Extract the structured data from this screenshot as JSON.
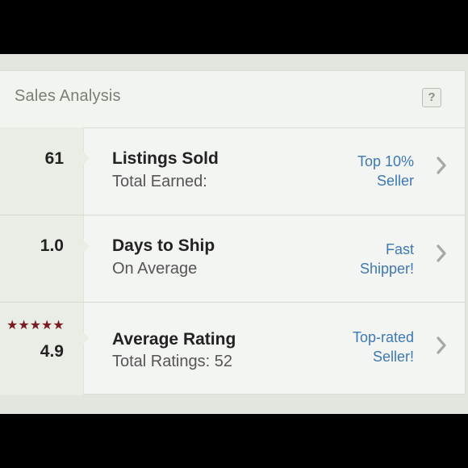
{
  "panel": {
    "title": "Sales Analysis",
    "help_label": "?"
  },
  "rows": [
    {
      "value": "61",
      "label": "Listings Sold",
      "sublabel": "Total Earned:",
      "badge_line1": "Top 10%",
      "badge_line2": "Seller"
    },
    {
      "value": "1.0",
      "label": "Days to Ship",
      "sublabel": "On Average",
      "badge_line1": "Fast",
      "badge_line2": "Shipper!"
    },
    {
      "value": "4.9",
      "stars": "★★★★★",
      "rating_stars": 5,
      "label": "Average Rating",
      "sublabel": "Total Ratings: 52",
      "badge_line1": "Top-rated",
      "badge_line2": "Seller!"
    }
  ],
  "colors": {
    "accent_link": "#3e78b2",
    "star": "#7a1b22"
  }
}
